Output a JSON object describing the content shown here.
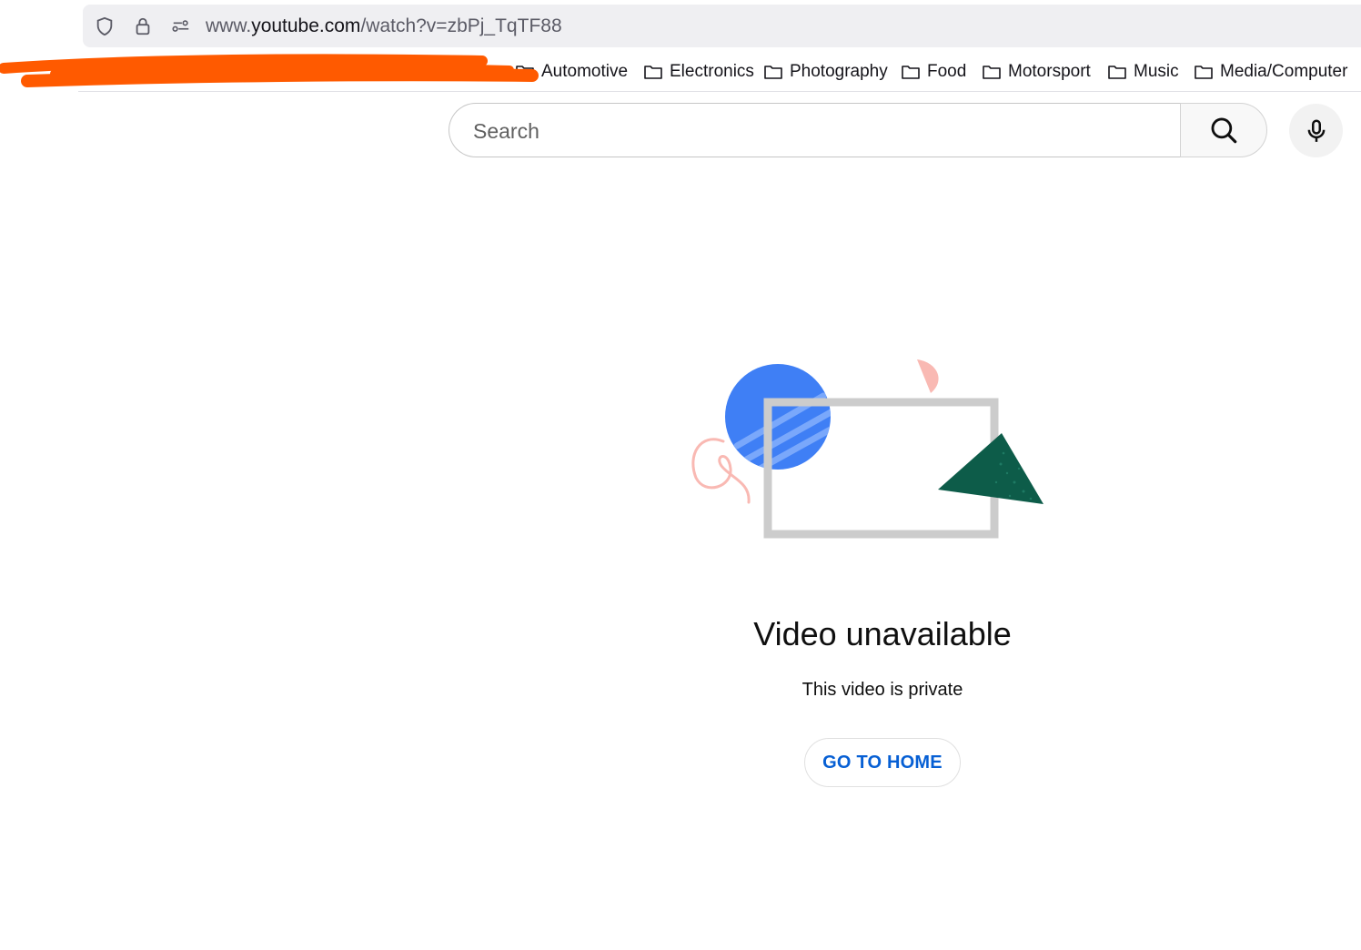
{
  "browser": {
    "url_host_prefix": "www.",
    "url_host": "youtube.com",
    "url_path": "/watch?v=zbPj_TqTF88"
  },
  "bookmarks": [
    {
      "label": "Automotive"
    },
    {
      "label": "Electronics"
    },
    {
      "label": "Photography"
    },
    {
      "label": "Food"
    },
    {
      "label": "Motorsport"
    },
    {
      "label": "Music"
    },
    {
      "label": "Media/Computer"
    }
  ],
  "search": {
    "placeholder": "Search"
  },
  "message": {
    "title": "Video unavailable",
    "subtitle": "This video is private",
    "home_button": "GO TO HOME"
  },
  "colors": {
    "redaction": "#ff5a00",
    "link_blue": "#065fd4",
    "circle_blue": "#3f7ff5",
    "triangle_green": "#0d5c49",
    "accent_pink": "#f9b9b3",
    "frame_gray": "#cccccc"
  },
  "icons": [
    "shield-icon",
    "lock-icon",
    "permissions-icon",
    "folder-icon",
    "search-icon",
    "mic-icon"
  ]
}
